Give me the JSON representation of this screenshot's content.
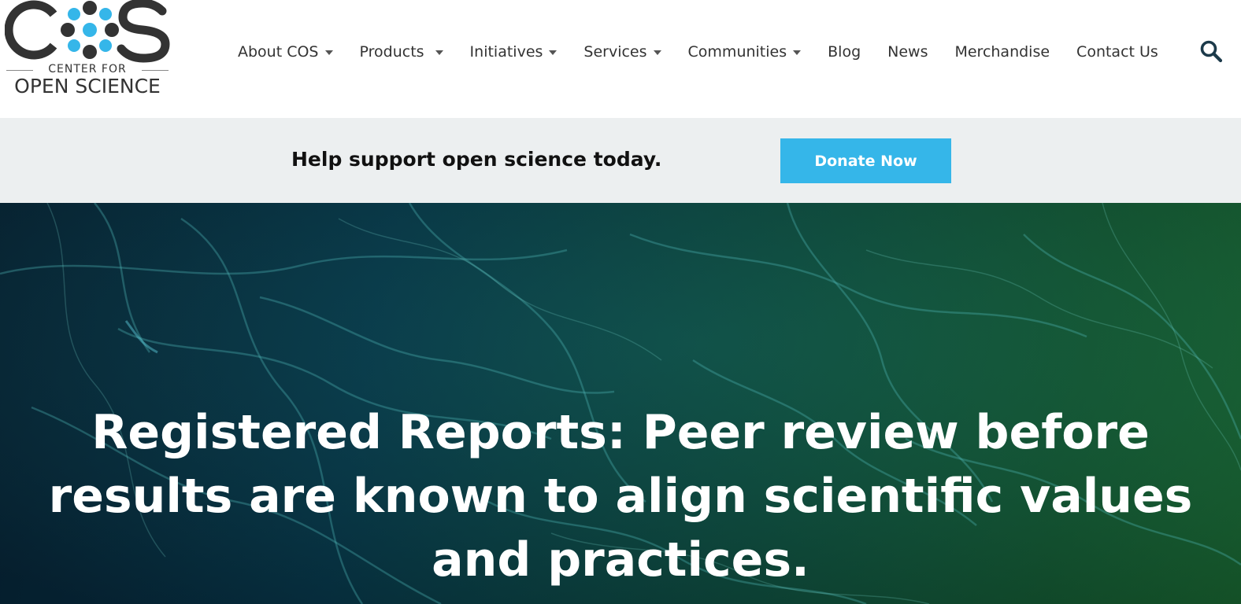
{
  "logo": {
    "mark": "COS",
    "line1": "CENTER FOR",
    "line2": "OPEN SCIENCE"
  },
  "nav": {
    "items": [
      {
        "label": "About COS",
        "dropdown": true
      },
      {
        "label": "Products",
        "dropdown": true
      },
      {
        "label": "Initiatives",
        "dropdown": true
      },
      {
        "label": "Services",
        "dropdown": true
      },
      {
        "label": "Communities",
        "dropdown": true
      },
      {
        "label": "Blog",
        "dropdown": false
      },
      {
        "label": "News",
        "dropdown": false
      },
      {
        "label": "Merchandise",
        "dropdown": false
      },
      {
        "label": "Contact Us",
        "dropdown": false
      }
    ],
    "search_icon": "search-icon"
  },
  "banner": {
    "text": "Help support open science today.",
    "button_label": "Donate Now"
  },
  "hero": {
    "title": "Registered Reports: Peer review before results are known to align scientific values and practices."
  },
  "colors": {
    "accent": "#35b6e9",
    "text_dark": "#333333",
    "banner_bg": "#eceff0",
    "hero_dark": "#07263a",
    "hero_green": "#1a6a33"
  }
}
